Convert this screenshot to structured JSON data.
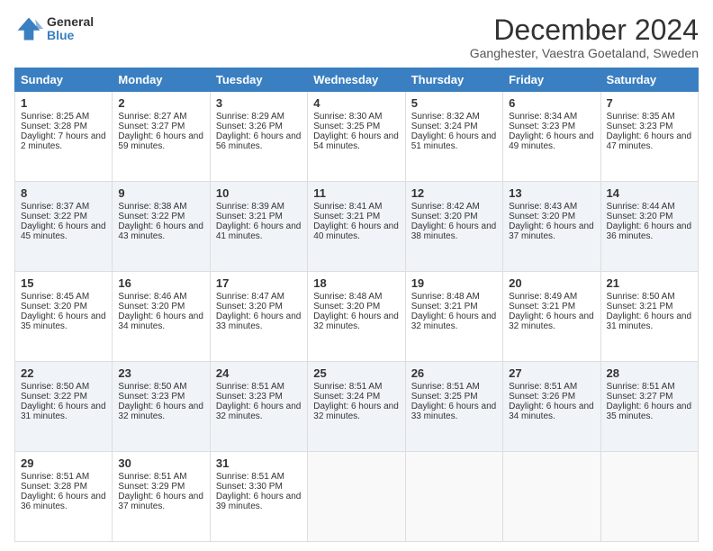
{
  "logo": {
    "general": "General",
    "blue": "Blue"
  },
  "title": "December 2024",
  "subtitle": "Ganghester, Vaestra Goetaland, Sweden",
  "days_of_week": [
    "Sunday",
    "Monday",
    "Tuesday",
    "Wednesday",
    "Thursday",
    "Friday",
    "Saturday"
  ],
  "weeks": [
    [
      {
        "day": "1",
        "sunrise": "Sunrise: 8:25 AM",
        "sunset": "Sunset: 3:28 PM",
        "daylight": "Daylight: 7 hours and 2 minutes."
      },
      {
        "day": "2",
        "sunrise": "Sunrise: 8:27 AM",
        "sunset": "Sunset: 3:27 PM",
        "daylight": "Daylight: 6 hours and 59 minutes."
      },
      {
        "day": "3",
        "sunrise": "Sunrise: 8:29 AM",
        "sunset": "Sunset: 3:26 PM",
        "daylight": "Daylight: 6 hours and 56 minutes."
      },
      {
        "day": "4",
        "sunrise": "Sunrise: 8:30 AM",
        "sunset": "Sunset: 3:25 PM",
        "daylight": "Daylight: 6 hours and 54 minutes."
      },
      {
        "day": "5",
        "sunrise": "Sunrise: 8:32 AM",
        "sunset": "Sunset: 3:24 PM",
        "daylight": "Daylight: 6 hours and 51 minutes."
      },
      {
        "day": "6",
        "sunrise": "Sunrise: 8:34 AM",
        "sunset": "Sunset: 3:23 PM",
        "daylight": "Daylight: 6 hours and 49 minutes."
      },
      {
        "day": "7",
        "sunrise": "Sunrise: 8:35 AM",
        "sunset": "Sunset: 3:23 PM",
        "daylight": "Daylight: 6 hours and 47 minutes."
      }
    ],
    [
      {
        "day": "8",
        "sunrise": "Sunrise: 8:37 AM",
        "sunset": "Sunset: 3:22 PM",
        "daylight": "Daylight: 6 hours and 45 minutes."
      },
      {
        "day": "9",
        "sunrise": "Sunrise: 8:38 AM",
        "sunset": "Sunset: 3:22 PM",
        "daylight": "Daylight: 6 hours and 43 minutes."
      },
      {
        "day": "10",
        "sunrise": "Sunrise: 8:39 AM",
        "sunset": "Sunset: 3:21 PM",
        "daylight": "Daylight: 6 hours and 41 minutes."
      },
      {
        "day": "11",
        "sunrise": "Sunrise: 8:41 AM",
        "sunset": "Sunset: 3:21 PM",
        "daylight": "Daylight: 6 hours and 40 minutes."
      },
      {
        "day": "12",
        "sunrise": "Sunrise: 8:42 AM",
        "sunset": "Sunset: 3:20 PM",
        "daylight": "Daylight: 6 hours and 38 minutes."
      },
      {
        "day": "13",
        "sunrise": "Sunrise: 8:43 AM",
        "sunset": "Sunset: 3:20 PM",
        "daylight": "Daylight: 6 hours and 37 minutes."
      },
      {
        "day": "14",
        "sunrise": "Sunrise: 8:44 AM",
        "sunset": "Sunset: 3:20 PM",
        "daylight": "Daylight: 6 hours and 36 minutes."
      }
    ],
    [
      {
        "day": "15",
        "sunrise": "Sunrise: 8:45 AM",
        "sunset": "Sunset: 3:20 PM",
        "daylight": "Daylight: 6 hours and 35 minutes."
      },
      {
        "day": "16",
        "sunrise": "Sunrise: 8:46 AM",
        "sunset": "Sunset: 3:20 PM",
        "daylight": "Daylight: 6 hours and 34 minutes."
      },
      {
        "day": "17",
        "sunrise": "Sunrise: 8:47 AM",
        "sunset": "Sunset: 3:20 PM",
        "daylight": "Daylight: 6 hours and 33 minutes."
      },
      {
        "day": "18",
        "sunrise": "Sunrise: 8:48 AM",
        "sunset": "Sunset: 3:20 PM",
        "daylight": "Daylight: 6 hours and 32 minutes."
      },
      {
        "day": "19",
        "sunrise": "Sunrise: 8:48 AM",
        "sunset": "Sunset: 3:21 PM",
        "daylight": "Daylight: 6 hours and 32 minutes."
      },
      {
        "day": "20",
        "sunrise": "Sunrise: 8:49 AM",
        "sunset": "Sunset: 3:21 PM",
        "daylight": "Daylight: 6 hours and 32 minutes."
      },
      {
        "day": "21",
        "sunrise": "Sunrise: 8:50 AM",
        "sunset": "Sunset: 3:21 PM",
        "daylight": "Daylight: 6 hours and 31 minutes."
      }
    ],
    [
      {
        "day": "22",
        "sunrise": "Sunrise: 8:50 AM",
        "sunset": "Sunset: 3:22 PM",
        "daylight": "Daylight: 6 hours and 31 minutes."
      },
      {
        "day": "23",
        "sunrise": "Sunrise: 8:50 AM",
        "sunset": "Sunset: 3:23 PM",
        "daylight": "Daylight: 6 hours and 32 minutes."
      },
      {
        "day": "24",
        "sunrise": "Sunrise: 8:51 AM",
        "sunset": "Sunset: 3:23 PM",
        "daylight": "Daylight: 6 hours and 32 minutes."
      },
      {
        "day": "25",
        "sunrise": "Sunrise: 8:51 AM",
        "sunset": "Sunset: 3:24 PM",
        "daylight": "Daylight: 6 hours and 32 minutes."
      },
      {
        "day": "26",
        "sunrise": "Sunrise: 8:51 AM",
        "sunset": "Sunset: 3:25 PM",
        "daylight": "Daylight: 6 hours and 33 minutes."
      },
      {
        "day": "27",
        "sunrise": "Sunrise: 8:51 AM",
        "sunset": "Sunset: 3:26 PM",
        "daylight": "Daylight: 6 hours and 34 minutes."
      },
      {
        "day": "28",
        "sunrise": "Sunrise: 8:51 AM",
        "sunset": "Sunset: 3:27 PM",
        "daylight": "Daylight: 6 hours and 35 minutes."
      }
    ],
    [
      {
        "day": "29",
        "sunrise": "Sunrise: 8:51 AM",
        "sunset": "Sunset: 3:28 PM",
        "daylight": "Daylight: 6 hours and 36 minutes."
      },
      {
        "day": "30",
        "sunrise": "Sunrise: 8:51 AM",
        "sunset": "Sunset: 3:29 PM",
        "daylight": "Daylight: 6 hours and 37 minutes."
      },
      {
        "day": "31",
        "sunrise": "Sunrise: 8:51 AM",
        "sunset": "Sunset: 3:30 PM",
        "daylight": "Daylight: 6 hours and 39 minutes."
      },
      null,
      null,
      null,
      null
    ]
  ],
  "colors": {
    "header_bg": "#3a7fc1",
    "header_text": "#ffffff",
    "row_even_bg": "#f0f4f8",
    "row_odd_bg": "#ffffff"
  }
}
